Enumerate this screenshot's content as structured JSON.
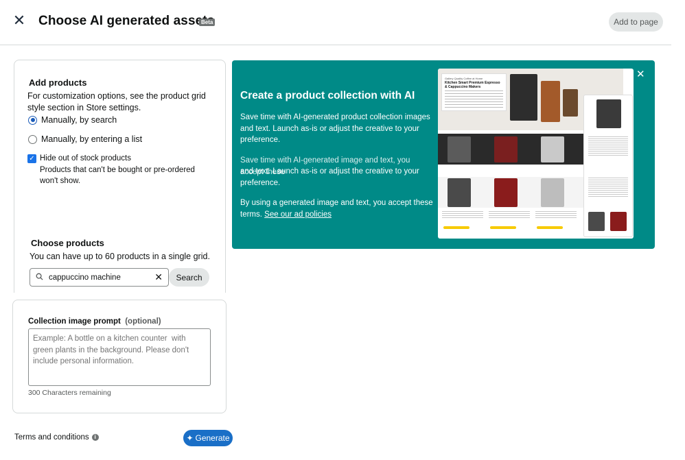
{
  "header": {
    "title": "Choose AI generated assets",
    "beta": "Beta",
    "add_to_page": "Add to page"
  },
  "products": {
    "title": "Add products",
    "description": "For customization options, see the product grid style section in Store settings.",
    "option_search": "Manually, by search",
    "option_list": "Manually, by entering a list",
    "selected_option": "Manually, by search",
    "hide_oos_label": "Hide out of stock products",
    "hide_oos_checked": true,
    "hide_oos_help": "Products that can't be bought or pre-ordered won't show.",
    "choose_title": "Choose products",
    "choose_help": "You can have up to 60 products in a single grid.",
    "search_value": "cappuccino machine",
    "search_button": "Search"
  },
  "prompt": {
    "label": "Collection image prompt",
    "optional": "(optional)",
    "placeholder": "Example: A bottle on a kitchen counter  with green plants in the background. Please don't include personal information.",
    "chars_remaining": "300 Characters remaining"
  },
  "footer": {
    "terms": "Terms and conditions",
    "generate": "Generate"
  },
  "banner": {
    "title": "Create a product collection with AI",
    "p1": "Save time with AI-generated product collection images and text. Launch as-is or adjust the creative to your preference.",
    "p2_overlap": "Save time with AI-generated image and text, you accept these",
    "p2": "and text. Launch as-is or adjust the creative to your preference.",
    "p3": "By using a generated image and text, you accept these terms.",
    "p3_link": "See our ad policies",
    "preview": {
      "hero_kicker": "Gallery Quality Coffee at Home",
      "hero_title": "Kitchen Smart Premium Espresso & Cappuccino Makers"
    }
  },
  "colors": {
    "banner_bg": "#008a87",
    "primary_button": "#1a6fc7",
    "checkbox": "#1a73e8"
  }
}
